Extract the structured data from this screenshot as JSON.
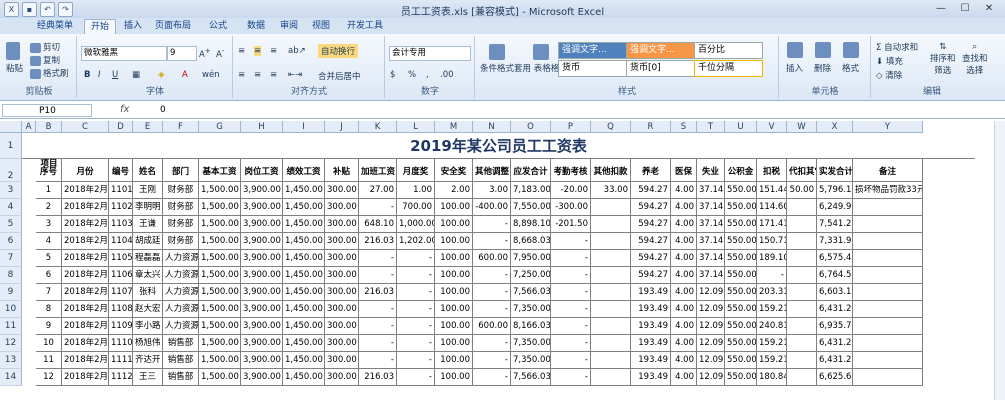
{
  "window": {
    "title": "员工工资表.xls [兼容模式] - Microsoft Excel",
    "min": "—",
    "max": "☐",
    "close": "✕"
  },
  "tabs": [
    "经典菜单",
    "开始",
    "插入",
    "页面布局",
    "公式",
    "数据",
    "审阅",
    "视图",
    "开发工具"
  ],
  "active_tab": "开始",
  "ribbon": {
    "clipboard": {
      "label": "剪贴板",
      "paste": "粘贴",
      "cut": "剪切",
      "copy": "复制",
      "painter": "格式刷"
    },
    "font": {
      "label": "字体",
      "name": "微软雅黑",
      "size": "9"
    },
    "align": {
      "label": "对齐方式",
      "wrap": "自动换行",
      "merge": "合并后居中"
    },
    "number": {
      "label": "数字",
      "format": "会计专用"
    },
    "styles": {
      "label": "样式",
      "cond": "条件格式",
      "table": "套用\n表格格式",
      "s1": "强调文字...",
      "s2": "强调文字...",
      "s3": "百分比",
      "s4": "货币",
      "s5": "货币[0]",
      "s6": "千位分隔"
    },
    "cells": {
      "label": "单元格",
      "insert": "插入",
      "delete": "删除",
      "format": "格式"
    },
    "edit": {
      "label": "编辑",
      "sum": "自动求和",
      "fill": "填充",
      "clear": "清除",
      "sort": "排序和\n筛选",
      "find": "查找和\n选择"
    }
  },
  "formula_bar": {
    "name_box": "P10",
    "fx": "fx",
    "value": "0"
  },
  "columns": [
    "A",
    "B",
    "C",
    "D",
    "E",
    "F",
    "G",
    "H",
    "I",
    "J",
    "K",
    "L",
    "M",
    "N",
    "O",
    "P",
    "Q",
    "R",
    "S",
    "T",
    "U",
    "V",
    "W",
    "X",
    "Y"
  ],
  "sheet_title": "2019年某公司员工工资表",
  "headers": [
    "序号",
    "月份",
    "编号",
    "姓名",
    "部门",
    "基本工资",
    "岗位工资",
    "绩效工资",
    "补贴",
    "加班工资",
    "月度奖",
    "安全奖",
    "其他调整",
    "应发合计",
    "考勤考核",
    "其他扣款",
    "养老",
    "医保",
    "失业",
    "公积金",
    "扣税",
    "代扣其它",
    "实发合计",
    "备注"
  ],
  "header_top_first": "项目",
  "rows": [
    [
      "1",
      "2018年2月",
      "1101",
      "王刚",
      "财务部",
      "1,500.00",
      "3,900.00",
      "1,450.00",
      "300.00",
      "27.00",
      "1.00",
      "2.00",
      "3.00",
      "7,183.00",
      "-20.00",
      "33.00",
      "594.27",
      "4.00",
      "37.14",
      "550.00",
      "151.44",
      "50.00",
      "5,796.15",
      "损坏物品罚款33元"
    ],
    [
      "2",
      "2018年2月",
      "1102",
      "李明明",
      "财务部",
      "1,500.00",
      "3,900.00",
      "1,450.00",
      "300.00",
      "-",
      "700.00",
      "100.00",
      "-400.00",
      "7,550.00",
      "-300.00",
      "",
      "594.27",
      "4.00",
      "37.14",
      "550.00",
      "114.60",
      "",
      "6,249.99",
      ""
    ],
    [
      "3",
      "2018年2月",
      "1103",
      "王谦",
      "财务部",
      "1,500.00",
      "3,900.00",
      "1,450.00",
      "300.00",
      "648.10",
      "1,000.00",
      "100.00",
      "-",
      "8,898.10",
      "-201.50",
      "",
      "594.27",
      "4.00",
      "37.14",
      "550.00",
      "171.41",
      "",
      "7,541.28",
      ""
    ],
    [
      "4",
      "2018年2月",
      "1104",
      "胡成廷",
      "财务部",
      "1,500.00",
      "3,900.00",
      "1,450.00",
      "300.00",
      "216.03",
      "1,202.00",
      "100.00",
      "-",
      "8,668.03",
      "-",
      "",
      "594.27",
      "4.00",
      "37.14",
      "550.00",
      "150.71",
      "",
      "7,331.91",
      ""
    ],
    [
      "5",
      "2018年2月",
      "1105",
      "程磊磊",
      "人力资源",
      "1,500.00",
      "3,900.00",
      "1,450.00",
      "300.00",
      "-",
      "-",
      "100.00",
      "600.00",
      "7,950.00",
      "-",
      "",
      "594.27",
      "4.00",
      "37.14",
      "550.00",
      "189.10",
      "",
      "6,575.49",
      ""
    ],
    [
      "6",
      "2018年2月",
      "1106",
      "章太兴",
      "人力资源",
      "1,500.00",
      "3,900.00",
      "1,450.00",
      "300.00",
      "-",
      "-",
      "100.00",
      "-",
      "7,250.00",
      "-",
      "",
      "594.27",
      "4.00",
      "37.14",
      "550.00",
      "-",
      "",
      "6,764.59",
      ""
    ],
    [
      "7",
      "2018年2月",
      "1107",
      "张科",
      "人力资源",
      "1,500.00",
      "3,900.00",
      "1,450.00",
      "300.00",
      "216.03",
      "-",
      "100.00",
      "-",
      "7,566.03",
      "-",
      "",
      "193.49",
      "4.00",
      "12.09",
      "550.00",
      "203.31",
      "",
      "6,603.14",
      ""
    ],
    [
      "8",
      "2018年2月",
      "1108",
      "赵大宏",
      "人力资源",
      "1,500.00",
      "3,900.00",
      "1,450.00",
      "300.00",
      "-",
      "-",
      "100.00",
      "-",
      "7,350.00",
      "-",
      "",
      "193.49",
      "4.00",
      "12.09",
      "550.00",
      "159.21",
      "",
      "6,431.21",
      ""
    ],
    [
      "9",
      "2018年2月",
      "1109",
      "李小路",
      "人力资源",
      "1,500.00",
      "3,900.00",
      "1,450.00",
      "300.00",
      "-",
      "-",
      "100.00",
      "600.00",
      "8,166.03",
      "-",
      "",
      "193.49",
      "4.00",
      "12.09",
      "550.00",
      "240.81",
      "",
      "6,935.76",
      ""
    ],
    [
      "10",
      "2018年2月",
      "1110",
      "杨旭伟",
      "销售部",
      "1,500.00",
      "3,900.00",
      "1,450.00",
      "300.00",
      "-",
      "-",
      "100.00",
      "-",
      "7,350.00",
      "-",
      "",
      "193.49",
      "4.00",
      "12.09",
      "550.00",
      "159.21",
      "",
      "6,431.21",
      ""
    ],
    [
      "11",
      "2018年2月",
      "1111",
      "齐达开",
      "销售部",
      "1,500.00",
      "3,900.00",
      "1,450.00",
      "300.00",
      "-",
      "-",
      "100.00",
      "-",
      "7,350.00",
      "-",
      "",
      "193.49",
      "4.00",
      "12.09",
      "550.00",
      "159.21",
      "",
      "6,431.21",
      ""
    ],
    [
      "12",
      "2018年2月",
      "1112",
      "王三",
      "销售部",
      "1,500.00",
      "3,900.00",
      "1,450.00",
      "300.00",
      "216.03",
      "-",
      "100.00",
      "-",
      "7,566.03",
      "-",
      "",
      "193.49",
      "4.00",
      "12.09",
      "550.00",
      "180.84",
      "",
      "6,625.64",
      ""
    ]
  ],
  "row_numbers": [
    "1",
    "2",
    "3",
    "4",
    "5",
    "6",
    "7",
    "8",
    "9",
    "10",
    "11",
    "12",
    "13",
    "14"
  ]
}
